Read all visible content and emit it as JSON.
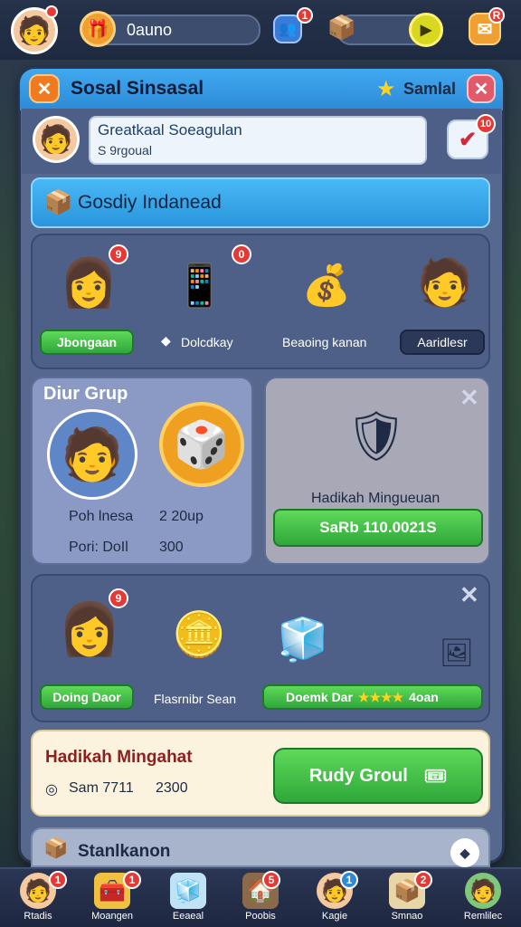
{
  "topbar": {
    "search_value": "0auno",
    "badge_1": "1",
    "badge_2": "R"
  },
  "panel": {
    "title": "Sosal Sinsasal",
    "star_label": "Samlal"
  },
  "profile": {
    "name": "Greatkaal Soeagulan",
    "sub": "S 9rgoual",
    "badge": "10"
  },
  "section_header": "Gosdiy Indanead",
  "rewards_row": [
    {
      "label": "Jbongaan",
      "badge": "9"
    },
    {
      "label": "Dolcdkay",
      "badge": "0"
    },
    {
      "label": "Beaoing kanan",
      "badge": ""
    },
    {
      "label": "Aaridlesr",
      "badge": ""
    }
  ],
  "group": {
    "title": "Diur Grup",
    "stat1_label": "Poh lnesa",
    "stat1_value": "2 20up",
    "stat2_label": "Pori: DoIl",
    "stat2_value": "300"
  },
  "daily_gift": {
    "title": "Hadikah Mingueuan",
    "button": "SaRb 110.0021S"
  },
  "row2": [
    {
      "label": "Doing Daor",
      "badge": "9"
    },
    {
      "label": "Flasrnibr Sean"
    },
    {
      "label": "Doemk Dar",
      "value": "4oan"
    }
  ],
  "weekly": {
    "title": "Hadikah Mingahat",
    "stat_label": "Sam 7711",
    "stat_value": "2300",
    "button": "Rudy Groul"
  },
  "bottom_card": {
    "title": "Stanlkanon"
  },
  "nav": [
    {
      "label": "Rtadis",
      "badge": "1",
      "icon": "avatar-icon"
    },
    {
      "label": "Moangen",
      "badge": "1",
      "icon": "chest-icon"
    },
    {
      "label": "Eeaeal",
      "badge": "",
      "icon": "ice-icon"
    },
    {
      "label": "Poobis",
      "badge": "5",
      "icon": "house-icon"
    },
    {
      "label": "Kagie",
      "badge": "1",
      "icon": "avatar-icon"
    },
    {
      "label": "Smnao",
      "badge": "2",
      "icon": "box-icon"
    },
    {
      "label": "Remlilec",
      "badge": "",
      "icon": "avatar-icon"
    }
  ]
}
